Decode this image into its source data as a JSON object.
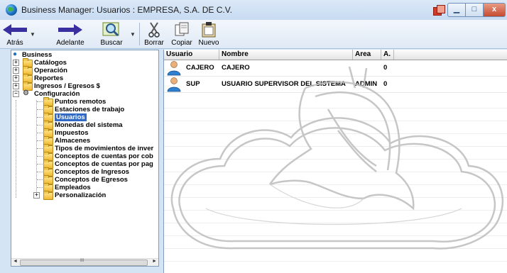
{
  "window": {
    "title": "Business Manager: Usuarios : EMPRESA, S.A. DE C.V.",
    "close_glyph": "x",
    "minimize_glyph": "▁",
    "maximize_glyph": "□"
  },
  "toolbar": {
    "back_label": "Atrás",
    "forward_label": "Adelante",
    "search_label": "Buscar",
    "delete_label": "Borrar",
    "copy_label": "Copiar",
    "new_label": "Nuevo"
  },
  "tree": {
    "root": "Business",
    "items": [
      {
        "label": "Catálogos"
      },
      {
        "label": "Operación"
      },
      {
        "label": "Reportes"
      },
      {
        "label": "Ingresos / Egresos $"
      },
      {
        "label": "Configuración"
      },
      {
        "label": "Puntos remotos"
      },
      {
        "label": "Estaciones de trabajo"
      },
      {
        "label": "Usuarios"
      },
      {
        "label": "Monedas del sistema"
      },
      {
        "label": "Impuestos"
      },
      {
        "label": "Almacenes"
      },
      {
        "label": "Tipos de movimientos de inver"
      },
      {
        "label": "Conceptos de cuentas por cob"
      },
      {
        "label": "Conceptos de cuentas por pag"
      },
      {
        "label": "Conceptos de Ingresos"
      },
      {
        "label": "Conceptos de Egresos"
      },
      {
        "label": "Empleados"
      },
      {
        "label": "Personalización"
      }
    ],
    "scroll_left_glyph": "◄",
    "scroll_right_glyph": "►",
    "scroll_thumb_glyph": "III"
  },
  "grid": {
    "columns": [
      "Usuario",
      "Nombre",
      "Area",
      "A."
    ],
    "rows": [
      {
        "usuario": "CAJERO",
        "nombre": "CAJERO",
        "area": "",
        "a": "0"
      },
      {
        "usuario": "SUP",
        "nombre": "USUARIO SUPERVISOR DEL SISTEMA",
        "area": "ADMIN",
        "a": "0"
      }
    ]
  },
  "colors": {
    "selection": "#316ac5",
    "titlebar": "#c7dbf2",
    "arrow": "#3a2ea0"
  }
}
